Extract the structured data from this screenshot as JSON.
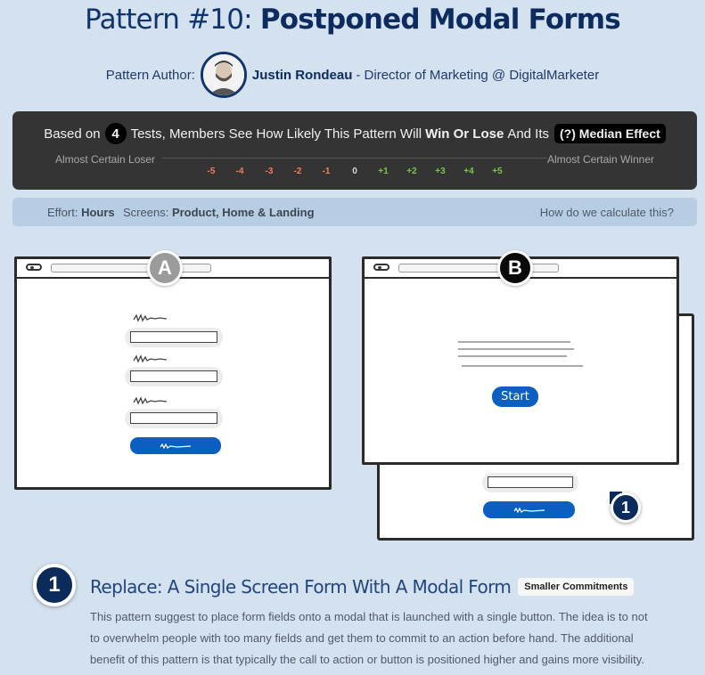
{
  "header": {
    "title_prefix": "Pattern #10:",
    "title_bold": "Postponed Modal Forms",
    "author_label": "Pattern Author:",
    "author_name": "Justin Rondeau",
    "author_role": "- Director of Marketing @ DigitalMarketer"
  },
  "score": {
    "text_before": "Based on",
    "tests_count": "4",
    "text_middle": "Tests, Members See How Likely This Pattern Will",
    "text_bold": "Win Or Lose",
    "text_after": "And Its",
    "median_badge": "(?) Median Effect",
    "left_label": "Almost Certain Loser",
    "right_label": "Almost Certain Winner",
    "ticks": [
      "-5",
      "-4",
      "-3",
      "-2",
      "-1",
      "0",
      "+1",
      "+2",
      "+3",
      "+4",
      "+5"
    ]
  },
  "info": {
    "effort_label": "Effort:",
    "effort_value": "Hours",
    "screens_label": "Screens:",
    "screens_value": "Product, Home & Landing",
    "calc_link": "How do we calculate this?"
  },
  "variants": {
    "a_label": "A",
    "b_label": "B",
    "start_button": "Start",
    "step_marker": "1",
    "a_badge_color": "#9b9b9b",
    "b_badge_color": "#0a0a0a",
    "button_color": "#0a5fc0"
  },
  "section": {
    "step_number": "1",
    "title": "Replace: A Single Screen Form With A Modal Form",
    "tag": "Smaller Commitments",
    "description": "This pattern suggest to place form fields onto a modal that is launched with a single button. The idea is to not to overwhelm people with too many fields and get them to commit to an action before hand. The additional benefit of this pattern is that typically the call to action or button is positioned higher and gains more visibility."
  }
}
